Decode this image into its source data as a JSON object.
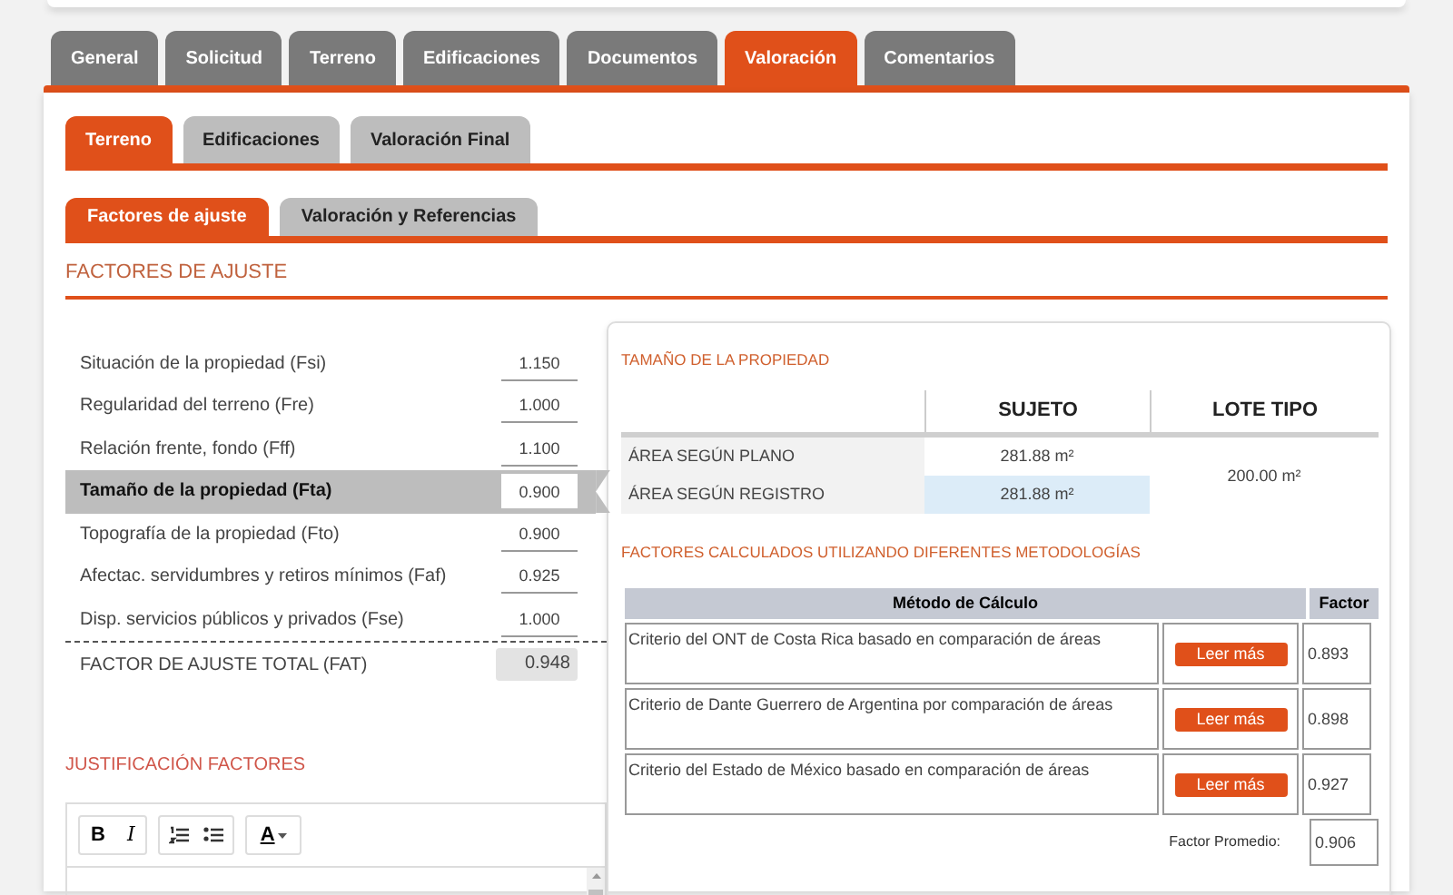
{
  "tabs": [
    {
      "label": "General",
      "selected": false
    },
    {
      "label": "Solicitud",
      "selected": false
    },
    {
      "label": "Terreno",
      "selected": false
    },
    {
      "label": "Edificaciones",
      "selected": false
    },
    {
      "label": "Documentos",
      "selected": false
    },
    {
      "label": "Valoración",
      "selected": true
    },
    {
      "label": "Comentarios",
      "selected": false
    }
  ],
  "subtabs": [
    {
      "label": "Terreno",
      "selected": true
    },
    {
      "label": "Edificaciones",
      "selected": false
    },
    {
      "label": "Valoración Final",
      "selected": false
    }
  ],
  "section_tabs": [
    {
      "label": "Factores de ajuste",
      "selected": true
    },
    {
      "label": "Valoración y Referencias",
      "selected": false
    }
  ],
  "section_title": "FACTORES DE AJUSTE",
  "factors": [
    {
      "label": "Situación de la propiedad (Fsi)",
      "value": "1.150",
      "selected": false
    },
    {
      "label": "Regularidad del terreno (Fre)",
      "value": "1.000",
      "selected": false
    },
    {
      "label": "Relación frente, fondo (Fff)",
      "value": "1.100",
      "selected": false
    },
    {
      "label": "Tamaño de la propiedad (Fta)",
      "value": "0.900",
      "selected": true
    },
    {
      "label": "Topografía de la propiedad (Fto)",
      "value": "0.900",
      "selected": false
    },
    {
      "label": "Afectac. servidumbres y retiros mínimos (Faf)",
      "value": "0.925",
      "selected": false
    },
    {
      "label": "Disp. servicios públicos y privados (Fse)",
      "value": "1.000",
      "selected": false
    }
  ],
  "total": {
    "label": "FACTOR DE AJUSTE TOTAL (FAT)",
    "value": "0.948"
  },
  "justification": {
    "title": "JUSTIFICACIÓN FACTORES",
    "bold": "B",
    "italic": "I",
    "font_color": "A"
  },
  "size_panel": {
    "title": "TAMAÑO DE LA PROPIEDAD",
    "columns": [
      "SUJETO",
      "LOTE TIPO"
    ],
    "rows": [
      {
        "label": "ÁREA SEGÚN PLANO",
        "value": "281.88 m²",
        "highlighted": false
      },
      {
        "label": "ÁREA SEGÚN REGISTRO",
        "value": "281.88 m²",
        "highlighted": true
      }
    ],
    "lote_tipo": "200.00 m²"
  },
  "methods": {
    "title": "FACTORES CALCULADOS UTILIZANDO DIFERENTES METODOLOGÍAS",
    "columns": [
      "Método de Cálculo",
      "Factor"
    ],
    "rows": [
      {
        "criterion": "Criterio del ONT de Costa Rica basado en comparación de áreas",
        "button": "Leer más",
        "factor": "0.893"
      },
      {
        "criterion": "Criterio de Dante Guerrero de Argentina por comparación de áreas",
        "button": "Leer más",
        "factor": "0.898"
      },
      {
        "criterion": "Criterio del Estado de México basado en comparación de áreas",
        "button": "Leer más",
        "factor": "0.927"
      }
    ],
    "average_label": "Factor Promedio:",
    "average": "0.906"
  }
}
